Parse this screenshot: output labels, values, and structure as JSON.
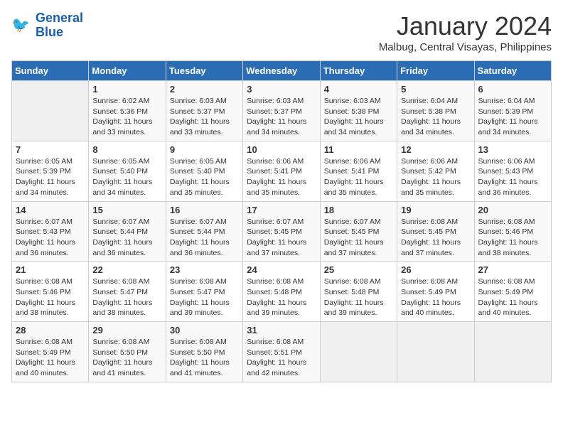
{
  "header": {
    "logo_line1": "General",
    "logo_line2": "Blue",
    "month_title": "January 2024",
    "location": "Malbug, Central Visayas, Philippines"
  },
  "days_of_week": [
    "Sunday",
    "Monday",
    "Tuesday",
    "Wednesday",
    "Thursday",
    "Friday",
    "Saturday"
  ],
  "weeks": [
    [
      {
        "day": "",
        "empty": true
      },
      {
        "day": "1",
        "sunrise": "6:02 AM",
        "sunset": "5:36 PM",
        "daylight": "11 hours and 33 minutes."
      },
      {
        "day": "2",
        "sunrise": "6:03 AM",
        "sunset": "5:37 PM",
        "daylight": "11 hours and 33 minutes."
      },
      {
        "day": "3",
        "sunrise": "6:03 AM",
        "sunset": "5:37 PM",
        "daylight": "11 hours and 34 minutes."
      },
      {
        "day": "4",
        "sunrise": "6:03 AM",
        "sunset": "5:38 PM",
        "daylight": "11 hours and 34 minutes."
      },
      {
        "day": "5",
        "sunrise": "6:04 AM",
        "sunset": "5:38 PM",
        "daylight": "11 hours and 34 minutes."
      },
      {
        "day": "6",
        "sunrise": "6:04 AM",
        "sunset": "5:39 PM",
        "daylight": "11 hours and 34 minutes."
      }
    ],
    [
      {
        "day": "7",
        "sunrise": "6:05 AM",
        "sunset": "5:39 PM",
        "daylight": "11 hours and 34 minutes."
      },
      {
        "day": "8",
        "sunrise": "6:05 AM",
        "sunset": "5:40 PM",
        "daylight": "11 hours and 34 minutes."
      },
      {
        "day": "9",
        "sunrise": "6:05 AM",
        "sunset": "5:40 PM",
        "daylight": "11 hours and 35 minutes."
      },
      {
        "day": "10",
        "sunrise": "6:06 AM",
        "sunset": "5:41 PM",
        "daylight": "11 hours and 35 minutes."
      },
      {
        "day": "11",
        "sunrise": "6:06 AM",
        "sunset": "5:41 PM",
        "daylight": "11 hours and 35 minutes."
      },
      {
        "day": "12",
        "sunrise": "6:06 AM",
        "sunset": "5:42 PM",
        "daylight": "11 hours and 35 minutes."
      },
      {
        "day": "13",
        "sunrise": "6:06 AM",
        "sunset": "5:43 PM",
        "daylight": "11 hours and 36 minutes."
      }
    ],
    [
      {
        "day": "14",
        "sunrise": "6:07 AM",
        "sunset": "5:43 PM",
        "daylight": "11 hours and 36 minutes."
      },
      {
        "day": "15",
        "sunrise": "6:07 AM",
        "sunset": "5:44 PM",
        "daylight": "11 hours and 36 minutes."
      },
      {
        "day": "16",
        "sunrise": "6:07 AM",
        "sunset": "5:44 PM",
        "daylight": "11 hours and 36 minutes."
      },
      {
        "day": "17",
        "sunrise": "6:07 AM",
        "sunset": "5:45 PM",
        "daylight": "11 hours and 37 minutes."
      },
      {
        "day": "18",
        "sunrise": "6:07 AM",
        "sunset": "5:45 PM",
        "daylight": "11 hours and 37 minutes."
      },
      {
        "day": "19",
        "sunrise": "6:08 AM",
        "sunset": "5:45 PM",
        "daylight": "11 hours and 37 minutes."
      },
      {
        "day": "20",
        "sunrise": "6:08 AM",
        "sunset": "5:46 PM",
        "daylight": "11 hours and 38 minutes."
      }
    ],
    [
      {
        "day": "21",
        "sunrise": "6:08 AM",
        "sunset": "5:46 PM",
        "daylight": "11 hours and 38 minutes."
      },
      {
        "day": "22",
        "sunrise": "6:08 AM",
        "sunset": "5:47 PM",
        "daylight": "11 hours and 38 minutes."
      },
      {
        "day": "23",
        "sunrise": "6:08 AM",
        "sunset": "5:47 PM",
        "daylight": "11 hours and 39 minutes."
      },
      {
        "day": "24",
        "sunrise": "6:08 AM",
        "sunset": "5:48 PM",
        "daylight": "11 hours and 39 minutes."
      },
      {
        "day": "25",
        "sunrise": "6:08 AM",
        "sunset": "5:48 PM",
        "daylight": "11 hours and 39 minutes."
      },
      {
        "day": "26",
        "sunrise": "6:08 AM",
        "sunset": "5:49 PM",
        "daylight": "11 hours and 40 minutes."
      },
      {
        "day": "27",
        "sunrise": "6:08 AM",
        "sunset": "5:49 PM",
        "daylight": "11 hours and 40 minutes."
      }
    ],
    [
      {
        "day": "28",
        "sunrise": "6:08 AM",
        "sunset": "5:49 PM",
        "daylight": "11 hours and 40 minutes."
      },
      {
        "day": "29",
        "sunrise": "6:08 AM",
        "sunset": "5:50 PM",
        "daylight": "11 hours and 41 minutes."
      },
      {
        "day": "30",
        "sunrise": "6:08 AM",
        "sunset": "5:50 PM",
        "daylight": "11 hours and 41 minutes."
      },
      {
        "day": "31",
        "sunrise": "6:08 AM",
        "sunset": "5:51 PM",
        "daylight": "11 hours and 42 minutes."
      },
      {
        "day": "",
        "empty": true
      },
      {
        "day": "",
        "empty": true
      },
      {
        "day": "",
        "empty": true
      }
    ]
  ],
  "labels": {
    "sunrise_prefix": "Sunrise: ",
    "sunset_prefix": "Sunset: ",
    "daylight_label": "Daylight: "
  }
}
